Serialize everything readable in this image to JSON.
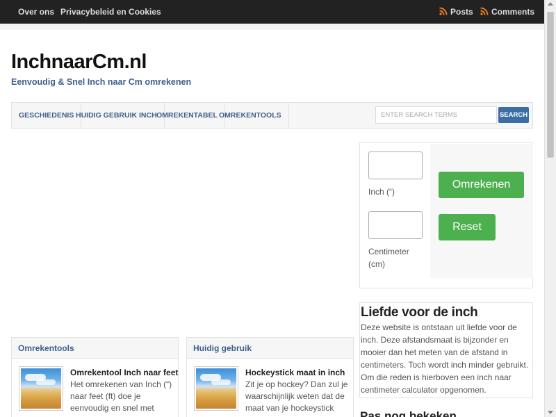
{
  "topbar": {
    "links": [
      "Over ons",
      "Privacybeleid en Cookies"
    ],
    "feeds": [
      "Posts",
      "Comments"
    ]
  },
  "site": {
    "title": "InchnaarCm.nl",
    "tagline": "Eenvoudig & Snel Inch naar Cm omrekenen"
  },
  "nav": {
    "items": [
      "GESCHIEDENIS",
      "HUIDIG GEBRUIK INCH",
      "OMREKENTABEL",
      "OMREKENTOOLS"
    ],
    "search_placeholder": "ENTER SEARCH TERMS",
    "search_button": "SEARCH"
  },
  "calculator": {
    "inch_label": "Inch (“)",
    "cm_label": "Centimeter (cm)",
    "convert_button": "Omrekenen",
    "reset_button": "Reset"
  },
  "love_box": {
    "title": "Liefde voor de inch",
    "text": "Deze website is ontstaan uit liefde voor de inch. Deze afstandsmaat is bijzonder en mooier dan het meten van de afstand in centimeters. Toch wordt inch minder gebruikt. Om die reden is hierboven een inch naar centimeter calculator opgenomen."
  },
  "bottom_box": {
    "title": "Pas nog bekeken"
  },
  "cards": [
    {
      "heading": "Omrekentools",
      "title": "Omrekentool Inch naar feet",
      "text": "Het omrekenen van Inch (“) naar feet (ft) doe je eenvoudig en snel met"
    },
    {
      "heading": "Huidig gebruik",
      "title": "Hockeystick maat in inch",
      "text": "Zit je op hockey? Dan zul je waarschijnlijk weten dat de maat van je hockeystick"
    }
  ],
  "colors": {
    "topbar": "#222222",
    "accent_blue": "#3d5f8b",
    "button_green": "#4cb04f",
    "rss_orange": "#f0821e"
  }
}
